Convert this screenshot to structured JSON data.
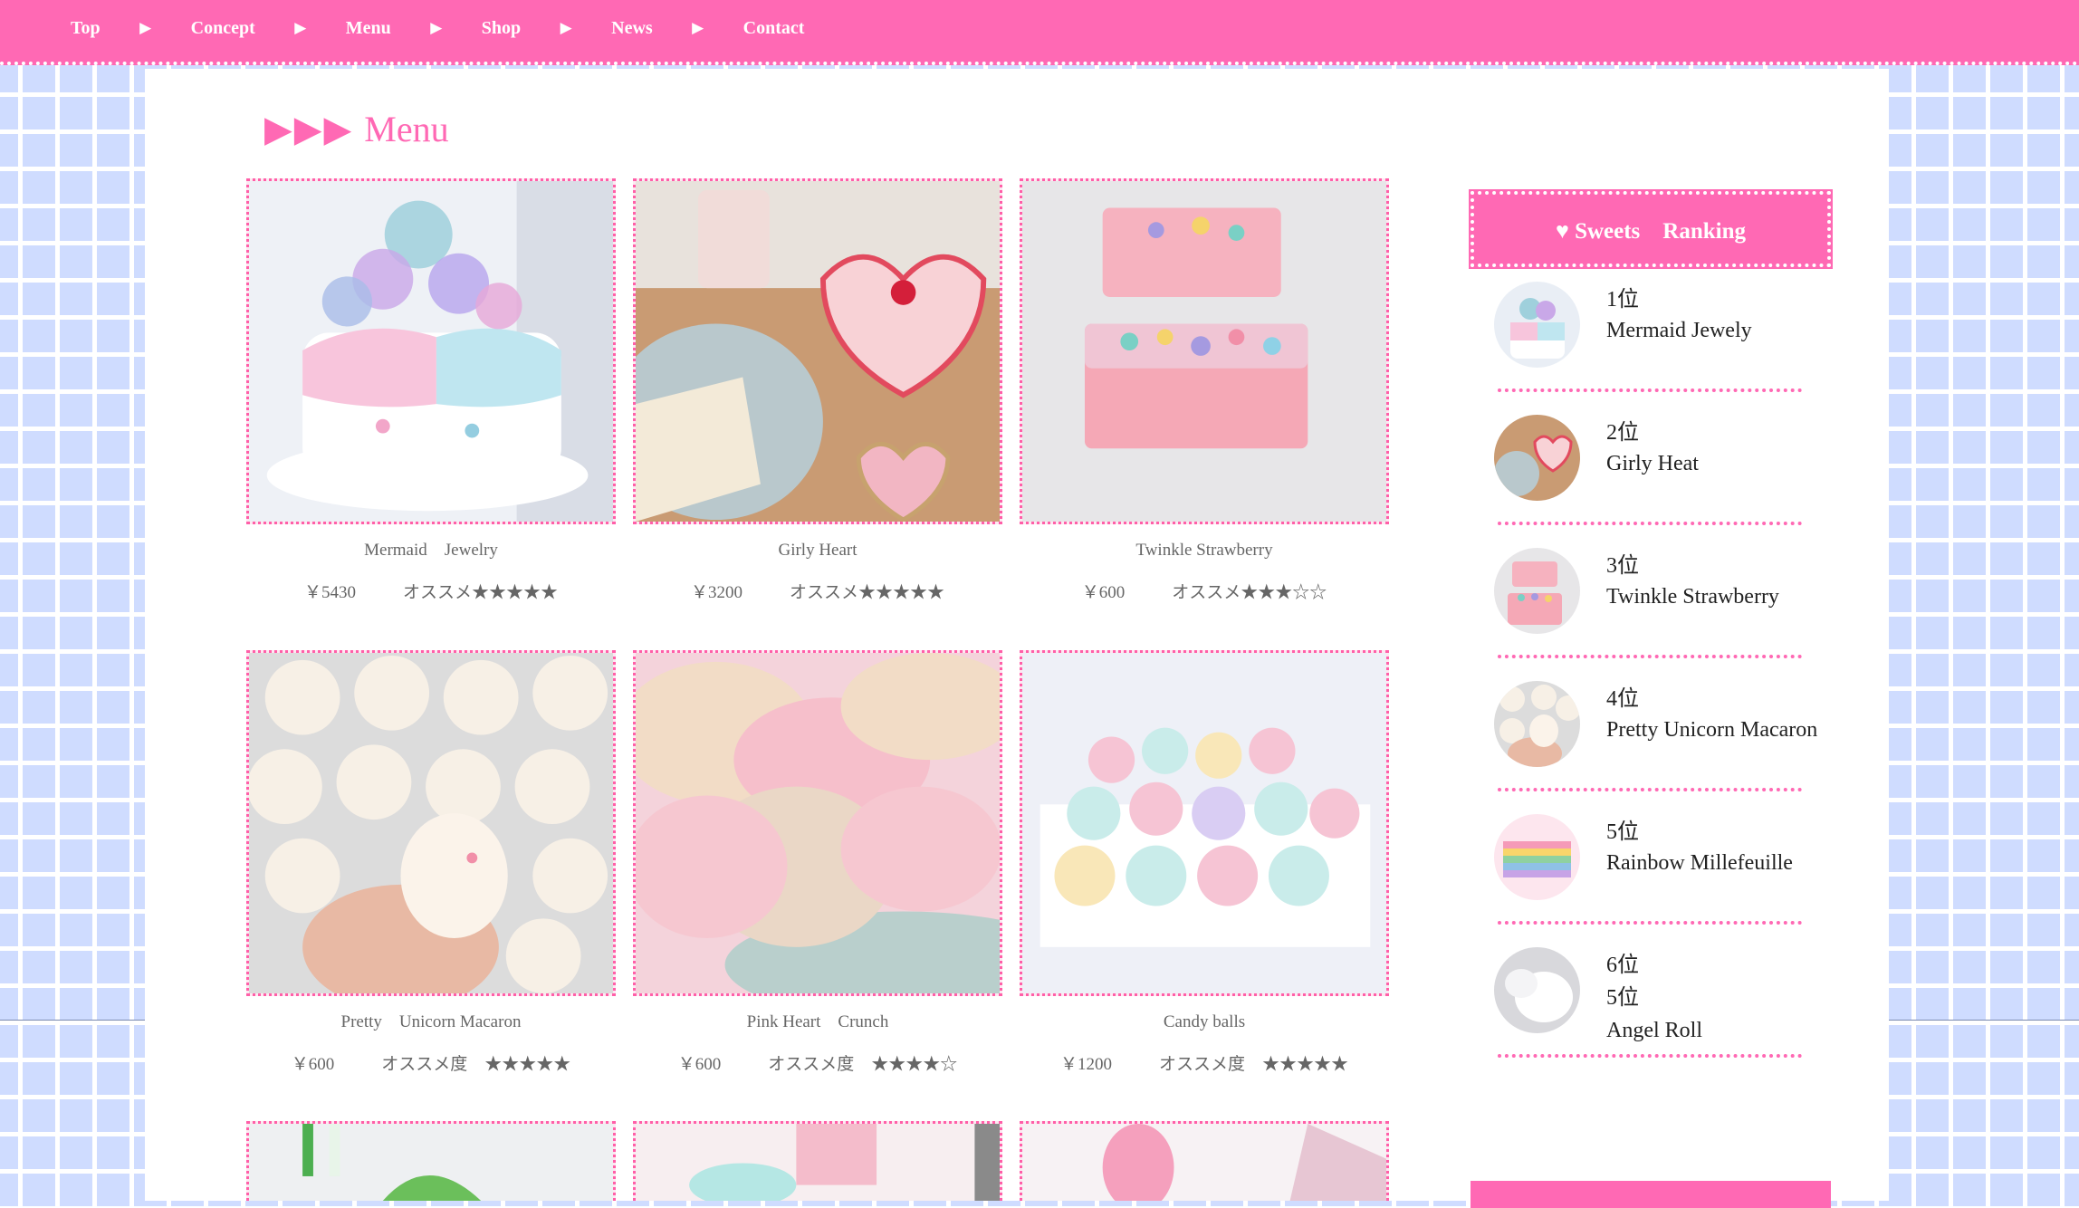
{
  "nav": {
    "items": [
      "Top",
      "Concept",
      "Menu",
      "Shop",
      "News",
      "Contact"
    ],
    "separator": "▶"
  },
  "section": {
    "arrows": "▶▶▶",
    "title": "Menu"
  },
  "menu_items": [
    {
      "name": "Mermaid　Jewelry",
      "price": "￥5430",
      "rating": "オススメ★★★★★"
    },
    {
      "name": "Girly Heart",
      "price": "￥3200",
      "rating": "オススメ★★★★★"
    },
    {
      "name": "Twinkle Strawberry",
      "price": "￥600",
      "rating": "オススメ★★★☆☆"
    },
    {
      "name": "Pretty　Unicorn Macaron",
      "price": "￥600",
      "rating": "オススメ度　★★★★★"
    },
    {
      "name": "Pink Heart　Crunch",
      "price": "￥600",
      "rating": "オススメ度　★★★★☆"
    },
    {
      "name": "Candy balls",
      "price": "￥1200",
      "rating": "オススメ度　★★★★★"
    }
  ],
  "ranking": {
    "title": "♥ Sweets　Ranking",
    "items": [
      {
        "position": "1位",
        "name": "Mermaid Jewely"
      },
      {
        "position": "2位",
        "name": "Girly Heat"
      },
      {
        "position": "3位",
        "name": "Twinkle Strawberry"
      },
      {
        "position": "4位",
        "name": "Pretty Unicorn Macaron"
      },
      {
        "position": "5位",
        "name": "Rainbow Millefeuille"
      },
      {
        "position": "6位",
        "position2": "5位",
        "name": "Angel Roll"
      }
    ]
  },
  "colors": {
    "accent": "#ff69b4",
    "grid_bg": "#cfdcff",
    "text_gray": "#666666"
  }
}
